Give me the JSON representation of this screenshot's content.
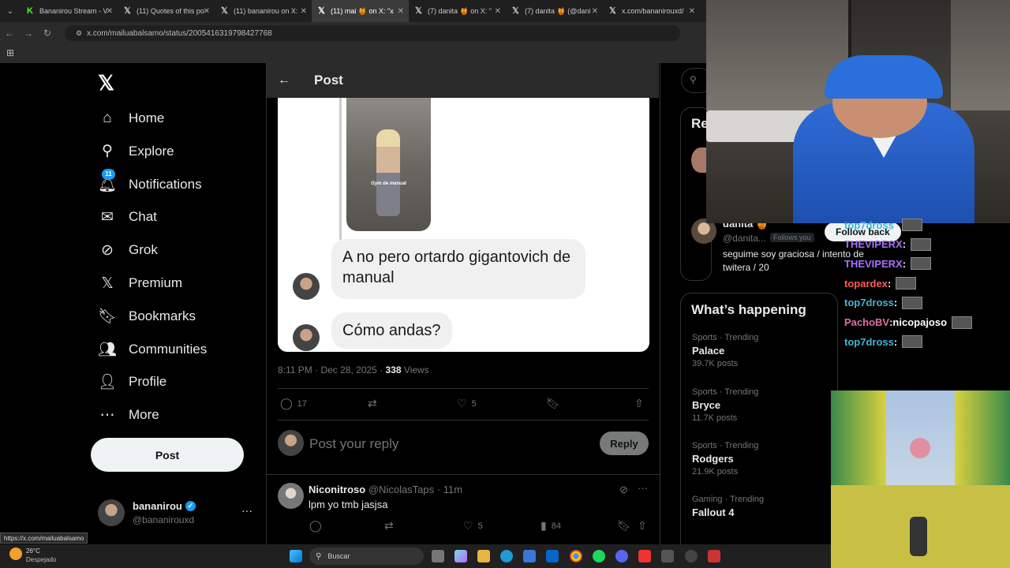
{
  "browser": {
    "tabs": [
      {
        "label": "Bananirou Stream - V",
        "icon": "kick-icon",
        "active": false
      },
      {
        "label": "(11) Quotes of this po",
        "icon": "x-icon",
        "active": false
      },
      {
        "label": "(11) bananirou on X:",
        "icon": "x-icon",
        "active": false
      },
      {
        "label": "(11) mai 🍯 on X: \"x",
        "icon": "x-icon",
        "active": true
      },
      {
        "label": "(7) danita 🍯 on X: \"",
        "icon": "x-icon",
        "active": false
      },
      {
        "label": "(7) danita 🍯 (@dani",
        "icon": "x-icon",
        "active": false
      },
      {
        "label": "x.com/bananirouxd/",
        "icon": "x-icon",
        "active": false
      }
    ],
    "url": "x.com/mailuabalsamo/status/2005416319798427768",
    "status_link": "https://x.com/mailuabalsamo"
  },
  "sidebar": {
    "items": [
      {
        "label": "Home",
        "icon": "home-icon"
      },
      {
        "label": "Explore",
        "icon": "search-icon"
      },
      {
        "label": "Notifications",
        "icon": "bell-icon",
        "badge": "11"
      },
      {
        "label": "Chat",
        "icon": "mail-icon"
      },
      {
        "label": "Grok",
        "icon": "grok-icon"
      },
      {
        "label": "Premium",
        "icon": "x-icon"
      },
      {
        "label": "Bookmarks",
        "icon": "bookmark-icon"
      },
      {
        "label": "Communities",
        "icon": "people-icon"
      },
      {
        "label": "Profile",
        "icon": "person-icon"
      },
      {
        "label": "More",
        "icon": "more-circle-icon"
      }
    ],
    "post_button": "Post",
    "account": {
      "name": "bananirou",
      "handle": "@bananirouxd",
      "more": "···"
    }
  },
  "post": {
    "header_title": "Post",
    "embedded_caption": "Gym de manual",
    "messages": [
      {
        "text": "A no pero ortardo gigantovich de manual"
      },
      {
        "text": "Cómo andas?"
      }
    ],
    "time": "8:11 PM · Dec 28, 2025 ·",
    "views_count": "338",
    "views_label": "Views",
    "stats": {
      "replies": "17",
      "likes": "5"
    },
    "reply_placeholder": "Post your reply",
    "reply_button": "Reply"
  },
  "reply": {
    "name": "Niconitroso",
    "handle": "@NicolasTaps",
    "time": "· 11m",
    "text": "lpm yo tmb jasjsa",
    "likes": "5",
    "views": "84"
  },
  "right": {
    "relevant_title": "Re",
    "suggested": {
      "name": "danita 🍯",
      "handle": "@danita...",
      "follows_you": "Follows you",
      "follow_back": "Follow back",
      "bio": "seguime soy graciosa / intento de twitera / 20"
    },
    "happening_title": "What’s happening",
    "trends": [
      {
        "meta": "Sports · Trending",
        "name": "Palace",
        "posts": "39.7K posts"
      },
      {
        "meta": "Sports · Trending",
        "name": "Bryce",
        "posts": "11.7K posts"
      },
      {
        "meta": "Sports · Trending",
        "name": "Rodgers",
        "posts": "21.9K posts"
      },
      {
        "meta": "Gaming · Trending",
        "name": "Fallout 4",
        "posts": ""
      }
    ]
  },
  "stream_chat": [
    {
      "user": "top7dross",
      "text": "",
      "color": "#3fb5d9"
    },
    {
      "user": "THEVIPERX",
      "text": "",
      "color": "#a970ff"
    },
    {
      "user": "THEVIPERX",
      "text": "",
      "color": "#a970ff"
    },
    {
      "user": "topardex",
      "text": "",
      "color": "#ff5a5a"
    },
    {
      "user": "top7dross",
      "text": "",
      "color": "#3fb5d9"
    },
    {
      "user": "PachoBV",
      "text": "nicopajoso",
      "color": "#e06fa0"
    },
    {
      "user": "top7dross",
      "text": "",
      "color": "#3fb5d9"
    }
  ],
  "taskbar": {
    "weather_temp": "26°C",
    "weather_desc": "Despejado",
    "search_label": "Buscar"
  }
}
